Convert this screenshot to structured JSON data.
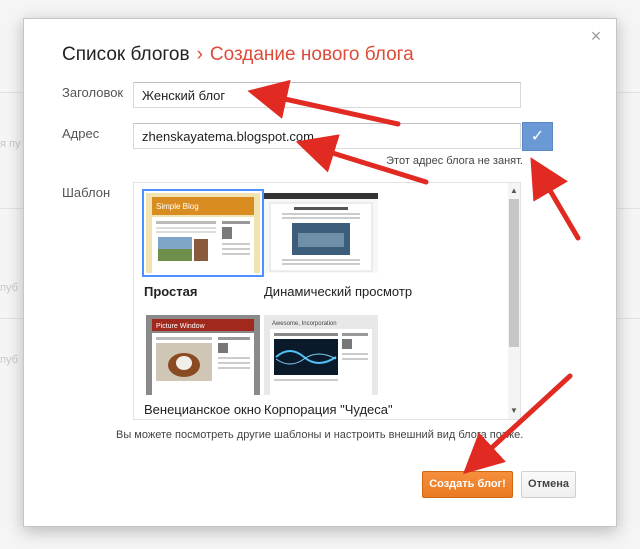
{
  "background": {
    "fragments": [
      "я пу",
      "пуб",
      "пуб"
    ]
  },
  "dialog": {
    "close_label": "×",
    "breadcrumb": {
      "parent": "Список блогов",
      "separator": "›",
      "current": "Создание нового блога"
    },
    "title_field": {
      "label": "Заголовок",
      "value": "Женский блог"
    },
    "address_field": {
      "label": "Адрес",
      "value": "zhenskayatema.blogspot.com",
      "check_icon": "checkmark-icon",
      "status": "Этот адрес блога не занят."
    },
    "template": {
      "label": "Шаблон",
      "items": [
        {
          "name": "Простая",
          "selected": true,
          "thumb_title": "Simple Blog"
        },
        {
          "name": "Динамический просмотр",
          "selected": false
        },
        {
          "name": "Венецианское окно",
          "selected": false,
          "thumb_title": "Picture Window"
        },
        {
          "name": "Корпорация \"Чудеса\"",
          "selected": false,
          "thumb_title": "Awesome, Incorporation"
        }
      ]
    },
    "hint": "Вы можете посмотреть другие шаблоны и настроить внешний вид блога позже.",
    "create_button": "Создать блог!",
    "cancel_button": "Отмена"
  },
  "colors": {
    "accent": "#dd4b39",
    "primary_button": "#f0862f",
    "check": "#6b99d6",
    "arrow": "#e02a22",
    "selection": "#4d90fe"
  }
}
